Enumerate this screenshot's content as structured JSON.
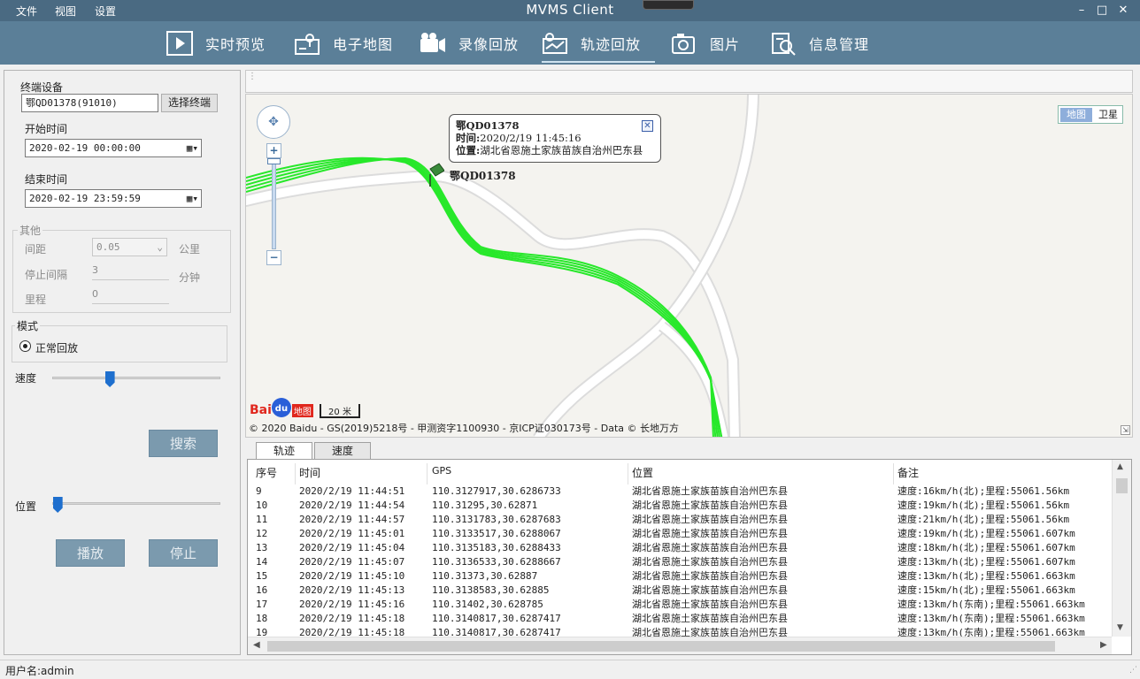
{
  "menu": {
    "file": "文件",
    "view": "视图",
    "settings": "设置"
  },
  "app_title": "MVMS Client",
  "window_buttons": {
    "minimize": "–",
    "maximize": "□",
    "close": "✕"
  },
  "toolbar": {
    "items": [
      {
        "label": "实时预览",
        "icon": "play-icon"
      },
      {
        "label": "电子地图",
        "icon": "map-icon"
      },
      {
        "label": "录像回放",
        "icon": "camera-icon"
      },
      {
        "label": "轨迹回放",
        "icon": "track-icon",
        "active": true
      },
      {
        "label": "图片",
        "icon": "picture-icon"
      },
      {
        "label": "信息管理",
        "icon": "info-manage-icon"
      }
    ]
  },
  "left": {
    "terminal_label": "终端设备",
    "terminal_value": "鄂QD01378(91010)",
    "select_terminal": "选择终端",
    "start_label": "开始时间",
    "start_value": "2020-02-19 00:00:00",
    "end_label": "结束时间",
    "end_value": "2020-02-19 23:59:59",
    "other_group": "其他",
    "distance_label": "间距",
    "distance_value": "0.05",
    "distance_unit": "公里",
    "stop_label": "停止间隔",
    "stop_value": "3",
    "stop_unit": "分钟",
    "mileage_label": "里程",
    "mileage_value": "0",
    "mode_group": "模式",
    "mode_option": "正常回放",
    "speed_label": "速度",
    "speed_level": 0.34,
    "search_btn": "搜索",
    "position_label": "位置",
    "position_level": 0.03,
    "play_btn": "播放",
    "stop_btn": "停止"
  },
  "map": {
    "popup": {
      "title": "鄂QD01378",
      "time_label": "时间:",
      "time_value": "2020/2/19 11:45:16",
      "pos_label": "位置:",
      "pos_value": "湖北省恩施土家族苗族自治州巴东县"
    },
    "vehicle_label": "鄂QD01378",
    "type_map": "地图",
    "type_sat": "卫星",
    "zoom_in": "+",
    "zoom_out": "−",
    "scale_label": "20 米",
    "logo_baidu": "Bai",
    "logo_du": "du",
    "logo_map": "地图",
    "copyright": "© 2020 Baidu - GS(2019)5218号 - 甲测资字1100930 - 京ICP证030173号 - Data © 长地万方",
    "track_color": "#27e82a"
  },
  "tabs": {
    "track": "轨迹",
    "speed": "速度"
  },
  "table": {
    "headers": [
      "序号",
      "时间",
      "GPS",
      "位置",
      "备注"
    ],
    "rows": [
      [
        "9",
        "2020/2/19 11:44:51",
        "110.3127917,30.6286733",
        "湖北省恩施土家族苗族自治州巴东县",
        "速度:16km/h(北);里程:55061.56km"
      ],
      [
        "10",
        "2020/2/19 11:44:54",
        "110.31295,30.62871",
        "湖北省恩施土家族苗族自治州巴东县",
        "速度:19km/h(北);里程:55061.56km"
      ],
      [
        "11",
        "2020/2/19 11:44:57",
        "110.3131783,30.6287683",
        "湖北省恩施土家族苗族自治州巴东县",
        "速度:21km/h(北);里程:55061.56km"
      ],
      [
        "12",
        "2020/2/19 11:45:01",
        "110.3133517,30.6288067",
        "湖北省恩施土家族苗族自治州巴东县",
        "速度:19km/h(北);里程:55061.607km"
      ],
      [
        "13",
        "2020/2/19 11:45:04",
        "110.3135183,30.6288433",
        "湖北省恩施土家族苗族自治州巴东县",
        "速度:18km/h(北);里程:55061.607km"
      ],
      [
        "14",
        "2020/2/19 11:45:07",
        "110.3136533,30.6288667",
        "湖北省恩施土家族苗族自治州巴东县",
        "速度:13km/h(北);里程:55061.607km"
      ],
      [
        "15",
        "2020/2/19 11:45:10",
        "110.31373,30.62887",
        "湖北省恩施土家族苗族自治州巴东县",
        "速度:13km/h(北);里程:55061.663km"
      ],
      [
        "16",
        "2020/2/19 11:45:13",
        "110.3138583,30.62885",
        "湖北省恩施土家族苗族自治州巴东县",
        "速度:15km/h(北);里程:55061.663km"
      ],
      [
        "17",
        "2020/2/19 11:45:16",
        "110.31402,30.628785",
        "湖北省恩施土家族苗族自治州巴东县",
        "速度:13km/h(东南);里程:55061.663km"
      ],
      [
        "18",
        "2020/2/19 11:45:18",
        "110.3140817,30.6287417",
        "湖北省恩施土家族苗族自治州巴东县",
        "速度:13km/h(东南);里程:55061.663km"
      ],
      [
        "19",
        "2020/2/19 11:45:18",
        "110.3140817,30.6287417",
        "湖北省恩施土家族苗族自治州巴东县",
        "速度:13km/h(东南);里程:55061.663km"
      ]
    ]
  },
  "status": {
    "user": "用户名:admin"
  }
}
